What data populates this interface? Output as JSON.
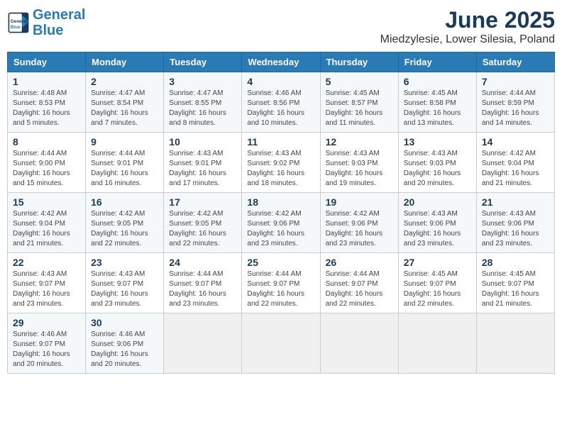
{
  "header": {
    "logo_line1": "General",
    "logo_line2": "Blue",
    "title": "June 2025",
    "subtitle": "Miedzylesie, Lower Silesia, Poland"
  },
  "weekdays": [
    "Sunday",
    "Monday",
    "Tuesday",
    "Wednesday",
    "Thursday",
    "Friday",
    "Saturday"
  ],
  "weeks": [
    [
      {
        "day": "1",
        "sunrise": "Sunrise: 4:48 AM",
        "sunset": "Sunset: 8:53 PM",
        "daylight": "Daylight: 16 hours and 5 minutes."
      },
      {
        "day": "2",
        "sunrise": "Sunrise: 4:47 AM",
        "sunset": "Sunset: 8:54 PM",
        "daylight": "Daylight: 16 hours and 7 minutes."
      },
      {
        "day": "3",
        "sunrise": "Sunrise: 4:47 AM",
        "sunset": "Sunset: 8:55 PM",
        "daylight": "Daylight: 16 hours and 8 minutes."
      },
      {
        "day": "4",
        "sunrise": "Sunrise: 4:46 AM",
        "sunset": "Sunset: 8:56 PM",
        "daylight": "Daylight: 16 hours and 10 minutes."
      },
      {
        "day": "5",
        "sunrise": "Sunrise: 4:45 AM",
        "sunset": "Sunset: 8:57 PM",
        "daylight": "Daylight: 16 hours and 11 minutes."
      },
      {
        "day": "6",
        "sunrise": "Sunrise: 4:45 AM",
        "sunset": "Sunset: 8:58 PM",
        "daylight": "Daylight: 16 hours and 13 minutes."
      },
      {
        "day": "7",
        "sunrise": "Sunrise: 4:44 AM",
        "sunset": "Sunset: 8:59 PM",
        "daylight": "Daylight: 16 hours and 14 minutes."
      }
    ],
    [
      {
        "day": "8",
        "sunrise": "Sunrise: 4:44 AM",
        "sunset": "Sunset: 9:00 PM",
        "daylight": "Daylight: 16 hours and 15 minutes."
      },
      {
        "day": "9",
        "sunrise": "Sunrise: 4:44 AM",
        "sunset": "Sunset: 9:01 PM",
        "daylight": "Daylight: 16 hours and 16 minutes."
      },
      {
        "day": "10",
        "sunrise": "Sunrise: 4:43 AM",
        "sunset": "Sunset: 9:01 PM",
        "daylight": "Daylight: 16 hours and 17 minutes."
      },
      {
        "day": "11",
        "sunrise": "Sunrise: 4:43 AM",
        "sunset": "Sunset: 9:02 PM",
        "daylight": "Daylight: 16 hours and 18 minutes."
      },
      {
        "day": "12",
        "sunrise": "Sunrise: 4:43 AM",
        "sunset": "Sunset: 9:03 PM",
        "daylight": "Daylight: 16 hours and 19 minutes."
      },
      {
        "day": "13",
        "sunrise": "Sunrise: 4:43 AM",
        "sunset": "Sunset: 9:03 PM",
        "daylight": "Daylight: 16 hours and 20 minutes."
      },
      {
        "day": "14",
        "sunrise": "Sunrise: 4:42 AM",
        "sunset": "Sunset: 9:04 PM",
        "daylight": "Daylight: 16 hours and 21 minutes."
      }
    ],
    [
      {
        "day": "15",
        "sunrise": "Sunrise: 4:42 AM",
        "sunset": "Sunset: 9:04 PM",
        "daylight": "Daylight: 16 hours and 21 minutes."
      },
      {
        "day": "16",
        "sunrise": "Sunrise: 4:42 AM",
        "sunset": "Sunset: 9:05 PM",
        "daylight": "Daylight: 16 hours and 22 minutes."
      },
      {
        "day": "17",
        "sunrise": "Sunrise: 4:42 AM",
        "sunset": "Sunset: 9:05 PM",
        "daylight": "Daylight: 16 hours and 22 minutes."
      },
      {
        "day": "18",
        "sunrise": "Sunrise: 4:42 AM",
        "sunset": "Sunset: 9:06 PM",
        "daylight": "Daylight: 16 hours and 23 minutes."
      },
      {
        "day": "19",
        "sunrise": "Sunrise: 4:42 AM",
        "sunset": "Sunset: 9:06 PM",
        "daylight": "Daylight: 16 hours and 23 minutes."
      },
      {
        "day": "20",
        "sunrise": "Sunrise: 4:43 AM",
        "sunset": "Sunset: 9:06 PM",
        "daylight": "Daylight: 16 hours and 23 minutes."
      },
      {
        "day": "21",
        "sunrise": "Sunrise: 4:43 AM",
        "sunset": "Sunset: 9:06 PM",
        "daylight": "Daylight: 16 hours and 23 minutes."
      }
    ],
    [
      {
        "day": "22",
        "sunrise": "Sunrise: 4:43 AM",
        "sunset": "Sunset: 9:07 PM",
        "daylight": "Daylight: 16 hours and 23 minutes."
      },
      {
        "day": "23",
        "sunrise": "Sunrise: 4:43 AM",
        "sunset": "Sunset: 9:07 PM",
        "daylight": "Daylight: 16 hours and 23 minutes."
      },
      {
        "day": "24",
        "sunrise": "Sunrise: 4:44 AM",
        "sunset": "Sunset: 9:07 PM",
        "daylight": "Daylight: 16 hours and 23 minutes."
      },
      {
        "day": "25",
        "sunrise": "Sunrise: 4:44 AM",
        "sunset": "Sunset: 9:07 PM",
        "daylight": "Daylight: 16 hours and 22 minutes."
      },
      {
        "day": "26",
        "sunrise": "Sunrise: 4:44 AM",
        "sunset": "Sunset: 9:07 PM",
        "daylight": "Daylight: 16 hours and 22 minutes."
      },
      {
        "day": "27",
        "sunrise": "Sunrise: 4:45 AM",
        "sunset": "Sunset: 9:07 PM",
        "daylight": "Daylight: 16 hours and 22 minutes."
      },
      {
        "day": "28",
        "sunrise": "Sunrise: 4:45 AM",
        "sunset": "Sunset: 9:07 PM",
        "daylight": "Daylight: 16 hours and 21 minutes."
      }
    ],
    [
      {
        "day": "29",
        "sunrise": "Sunrise: 4:46 AM",
        "sunset": "Sunset: 9:07 PM",
        "daylight": "Daylight: 16 hours and 20 minutes."
      },
      {
        "day": "30",
        "sunrise": "Sunrise: 4:46 AM",
        "sunset": "Sunset: 9:06 PM",
        "daylight": "Daylight: 16 hours and 20 minutes."
      },
      null,
      null,
      null,
      null,
      null
    ]
  ]
}
